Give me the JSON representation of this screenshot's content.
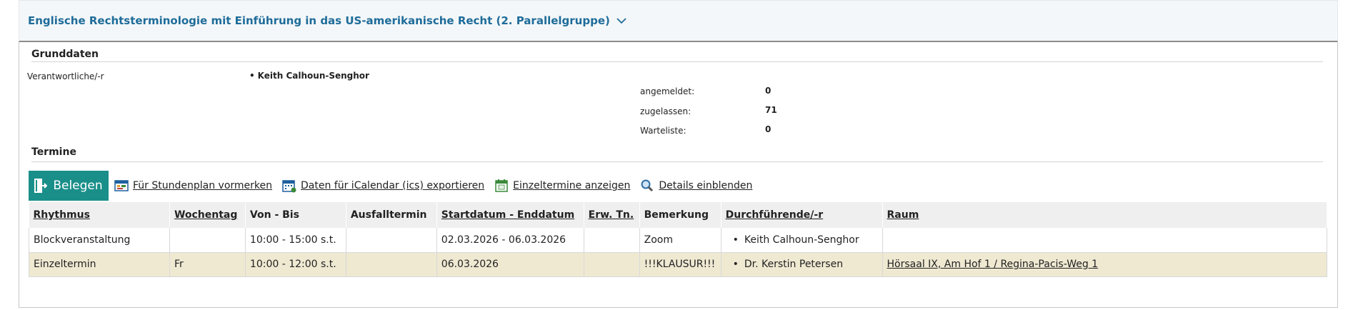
{
  "course": {
    "title": "Englische Rechtsterminologie mit Einführung in das US-amerikanische Recht (2. Parallelgruppe)"
  },
  "grunddaten": {
    "section_title": "Grunddaten",
    "responsible_label": "Verantwortliche/-r",
    "responsible_value": "Keith Calhoun-Senghor",
    "angemeldet_label": "angemeldet:",
    "angemeldet_value": "0",
    "zugelassen_label": "zugelassen:",
    "zugelassen_value": "71",
    "warteliste_label": "Warteliste:",
    "warteliste_value": "0"
  },
  "termine": {
    "section_title": "Termine",
    "toolbar": {
      "belegen": "Belegen",
      "stundenplan": "Für Stundenplan vormerken",
      "icalendar": "Daten für iCalendar (ics) exportieren",
      "einzeltermine": "Einzeltermine anzeigen",
      "details": "Details einblenden"
    },
    "columns": [
      "Rhythmus",
      "Wochentag",
      "Von - Bis",
      "Ausfalltermin",
      "Startdatum - Enddatum",
      "Erw. Tn.",
      "Bemerkung",
      "Durchführende/-r",
      "Raum"
    ],
    "rows": [
      {
        "rhythmus": "Blockveranstaltung",
        "wochentag": "",
        "von_bis": "10:00 - 15:00 s.t.",
        "ausfall": "",
        "datum": "02.03.2026 - 06.03.2026",
        "erw_tn": "",
        "bemerkung": "Zoom",
        "durchfuehrende": "Keith Calhoun-Senghor",
        "raum": ""
      },
      {
        "rhythmus": "Einzeltermin",
        "wochentag": "Fr",
        "von_bis": "10:00 - 12:00 s.t.",
        "ausfall": "",
        "datum": "06.03.2026",
        "erw_tn": "",
        "bemerkung": "!!!KLAUSUR!!!",
        "durchfuehrende": "Dr. Kerstin Petersen",
        "raum": "Hörsaal IX, Am Hof 1 / Regina-Pacis-Weg 1"
      }
    ]
  },
  "colors": {
    "title_blue": "#1e6c9a",
    "belegen_teal": "#1a8f8a",
    "highlight_row": "#efe9d2"
  },
  "icons": {
    "chevron": "chevron-down-icon",
    "belegen": "enter-door-icon",
    "stundenplan": "schedule-icon",
    "icalendar": "calendar-export-icon",
    "einzeltermine": "calendar-day-icon",
    "details": "magnifier-icon"
  }
}
